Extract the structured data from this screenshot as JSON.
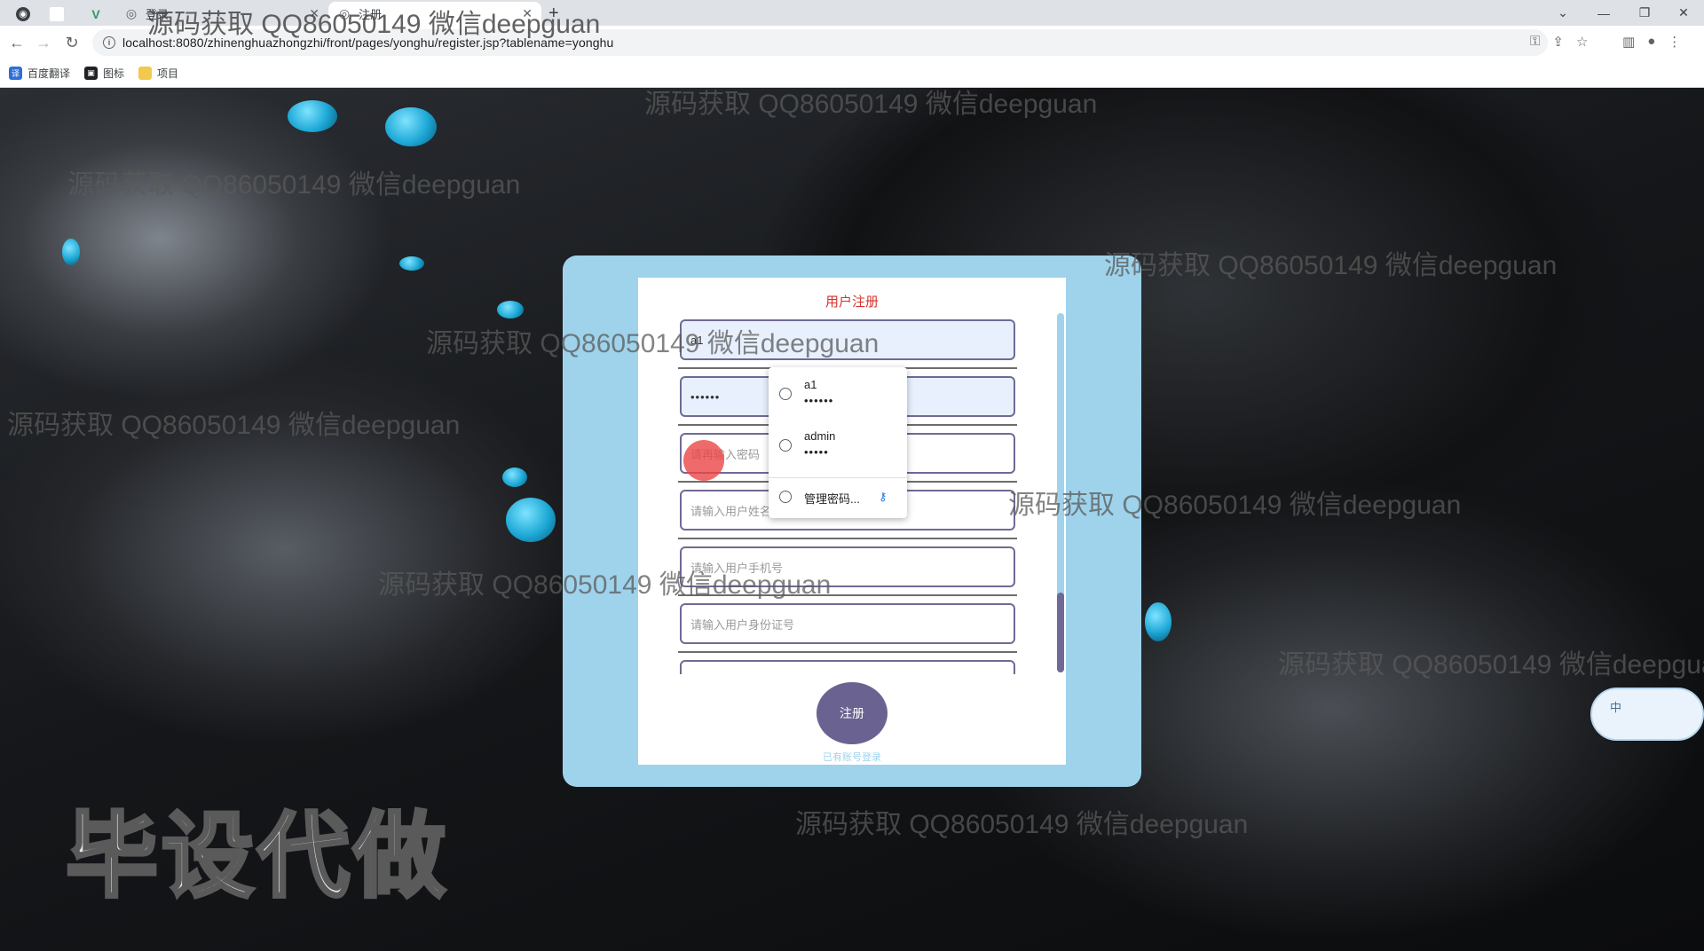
{
  "browser": {
    "tabs": [
      {
        "label": ""
      },
      {
        "label": ""
      },
      {
        "label": ""
      },
      {
        "label": "登录"
      },
      {
        "label": "注册"
      }
    ],
    "url": "localhost:8080/zhinenghuazhongzhi/front/pages/yonghu/register.jsp?tablename=yonghu",
    "bookmarks": [
      {
        "label": "百度翻译"
      },
      {
        "label": "图标"
      },
      {
        "label": "项目"
      }
    ]
  },
  "form": {
    "title": "用户注册",
    "fields": {
      "username_value": "a1",
      "password_value": "••••••",
      "confirm_placeholder": "请再输入密码",
      "name_placeholder": "请输入用户姓名",
      "phone_placeholder": "请输入用户手机号",
      "idcard_placeholder": "请输入用户身份证号"
    },
    "register_label": "注册",
    "login_link": "已有账号登录"
  },
  "autofill": {
    "entries": [
      {
        "user": "a1",
        "pass": "••••••"
      },
      {
        "user": "admin",
        "pass": "•••••"
      }
    ],
    "manage_label": "管理密码..."
  },
  "ime": {
    "label": "中"
  },
  "watermarks": {
    "text": "源码获取 QQ86050149 微信deepguan",
    "big": "毕设代做"
  }
}
